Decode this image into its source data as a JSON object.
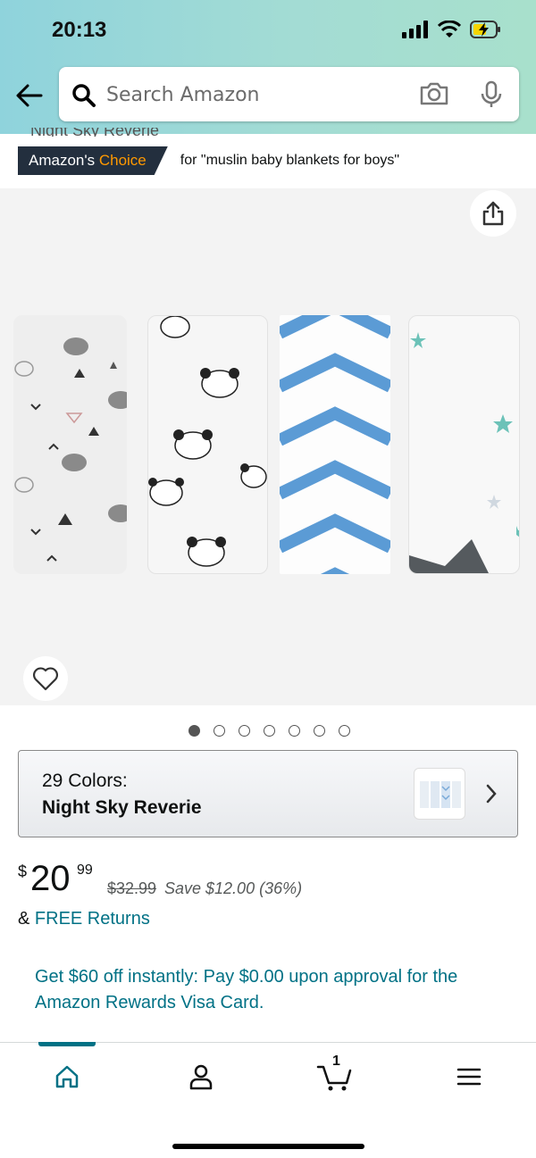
{
  "status_bar": {
    "time": "20:13"
  },
  "search": {
    "placeholder": "Search Amazon"
  },
  "product": {
    "title_peek": "Night Sky Reverie",
    "badge": {
      "prefix": "Amazon's",
      "highlight": "Choice",
      "query": "for \"muslin baby blankets for boys\""
    },
    "image_carousel": {
      "total": 7,
      "active_index": 0
    },
    "variant": {
      "label": "29 Colors:",
      "value": "Night Sky Reverie"
    },
    "price": {
      "symbol": "$",
      "whole": "20",
      "fraction": "99",
      "list_price": "$32.99",
      "savings": "Save $12.00 (36%)"
    },
    "returns": {
      "prefix": "&",
      "link": "FREE Returns"
    },
    "promo": "Get $60 off instantly: Pay $0.00 upon approval for the Amazon Rewards Visa Card."
  },
  "bottom_nav": {
    "items": [
      {
        "name": "home",
        "icon": "home-icon",
        "active": true
      },
      {
        "name": "account",
        "icon": "person-icon"
      },
      {
        "name": "cart",
        "icon": "cart-icon",
        "count": "1"
      },
      {
        "name": "menu",
        "icon": "menu-icon"
      }
    ]
  },
  "colors": {
    "accent": "#007185",
    "badge_bg": "#232f3e",
    "badge_orange": "#ff9900"
  }
}
